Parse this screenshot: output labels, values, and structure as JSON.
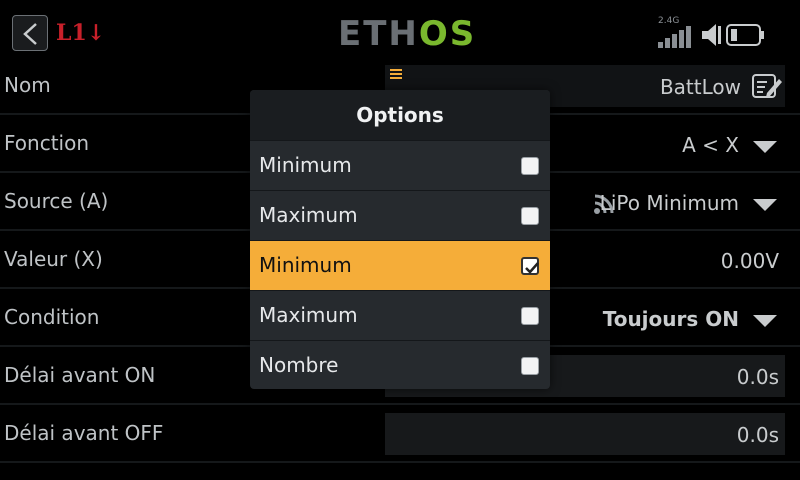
{
  "header": {
    "switch_badge": "L1",
    "logo_left": "ETH",
    "logo_right": "OS",
    "radio_band": "2.4G"
  },
  "rows": [
    {
      "label": "Nom",
      "value": "BattLow"
    },
    {
      "label": "Fonction",
      "value": "A < X"
    },
    {
      "label": "Source (A)",
      "value": "LiPo Minimum"
    },
    {
      "label": "Valeur (X)",
      "value": "0.00V"
    },
    {
      "label": "Condition",
      "value": "Toujours ON"
    },
    {
      "label": "Délai avant ON",
      "value": "0.0s"
    },
    {
      "label": "Délai avant OFF",
      "value": "0.0s"
    }
  ],
  "modal": {
    "title": "Options",
    "options": [
      {
        "label": "Minimum",
        "checked": false
      },
      {
        "label": "Maximum",
        "checked": false
      },
      {
        "label": "Minimum",
        "checked": true
      },
      {
        "label": "Maximum",
        "checked": false
      },
      {
        "label": "Nombre",
        "checked": false
      }
    ]
  },
  "colors": {
    "accent": "#f5ad39",
    "logo_green": "#7ab82e",
    "badge_red": "#c8202a"
  }
}
